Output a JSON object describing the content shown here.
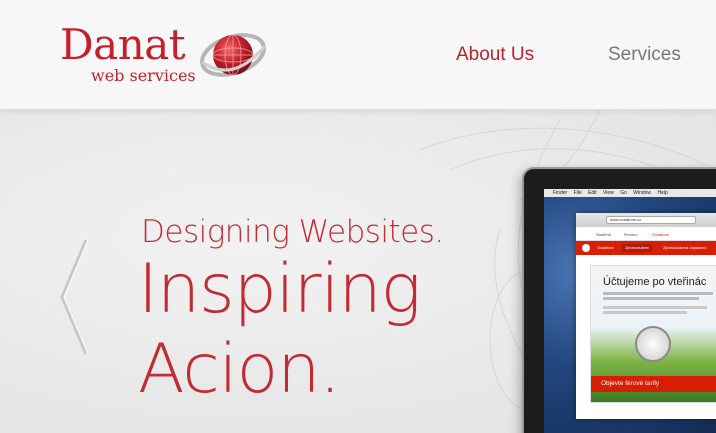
{
  "header": {
    "logo": {
      "name": "Danat",
      "tagline": "web services"
    },
    "nav": [
      {
        "label": "About Us",
        "active": true
      },
      {
        "label": "Services",
        "active": false
      }
    ]
  },
  "hero": {
    "tagline": "Designing Websites.",
    "headline_line1": "Inspiring",
    "headline_line2": "Acion."
  },
  "laptop_screen": {
    "menubar": [
      "Finder",
      "File",
      "Edit",
      "View",
      "Go",
      "Window",
      "Help"
    ],
    "url": "www.vodafone.cz",
    "site_nav": [
      "Studenti",
      "Firemní",
      "Vodafone"
    ],
    "red_tabs": [
      "Vodafone",
      "Zjednodušení",
      "Zjednodušená zaplacení"
    ],
    "promo_title": "Účtujeme po vteřinác",
    "promo_button": "Objevte férové tarify"
  },
  "colors": {
    "brand_red": "#c22b33",
    "nav_inactive": "#777777",
    "vodafone_red": "#d81e05"
  }
}
